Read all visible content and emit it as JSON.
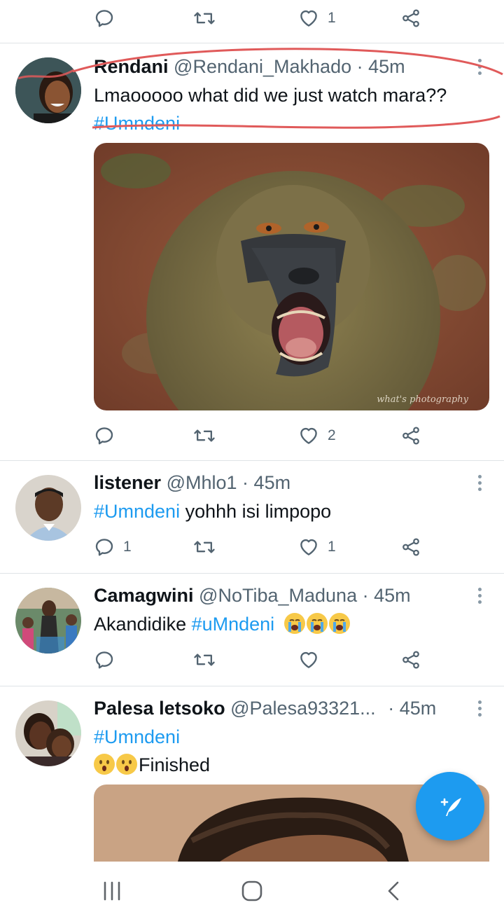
{
  "top_actions": {
    "like_count": "1"
  },
  "tweets": [
    {
      "name": "Rendani",
      "handle": "@Rendani_Makhado",
      "dot": "·",
      "time": "45m",
      "text": "Lmaooooo what did we just watch mara??",
      "hashtag": "#Umndeni",
      "media_watermark": "what's photography",
      "like_count": "2"
    },
    {
      "name": "listener",
      "handle": "@Mhlo1",
      "dot": "·",
      "time": "45m",
      "hashtag": "#Umndeni",
      "text": " yohhh isi limpopo",
      "reply_count": "1",
      "like_count": "1"
    },
    {
      "name": "Camagwini",
      "handle": "@NoTiba_Maduna",
      "dot": "·",
      "time": "45m",
      "text": "Akandidike ",
      "hashtag": "#uMndeni",
      "emojis": [
        "loudly-crying-face",
        "loudly-crying-face",
        "loudly-crying-face"
      ]
    },
    {
      "name": "Palesa letsoko",
      "handle": "@Palesa93321...",
      "dot": "·",
      "time": "45m",
      "hashtag": "#Umndeni",
      "emojis": [
        "hushed-face",
        "hushed-face"
      ],
      "text": "Finished"
    }
  ],
  "icons": [
    "reply-icon",
    "retweet-icon",
    "like-icon",
    "share-icon",
    "more-icon",
    "compose-icon",
    "recents-icon",
    "home-icon",
    "back-icon"
  ],
  "colors": {
    "accent": "#1d9bf0",
    "annotation": "#e05a5a",
    "secondary_text": "#536471"
  }
}
